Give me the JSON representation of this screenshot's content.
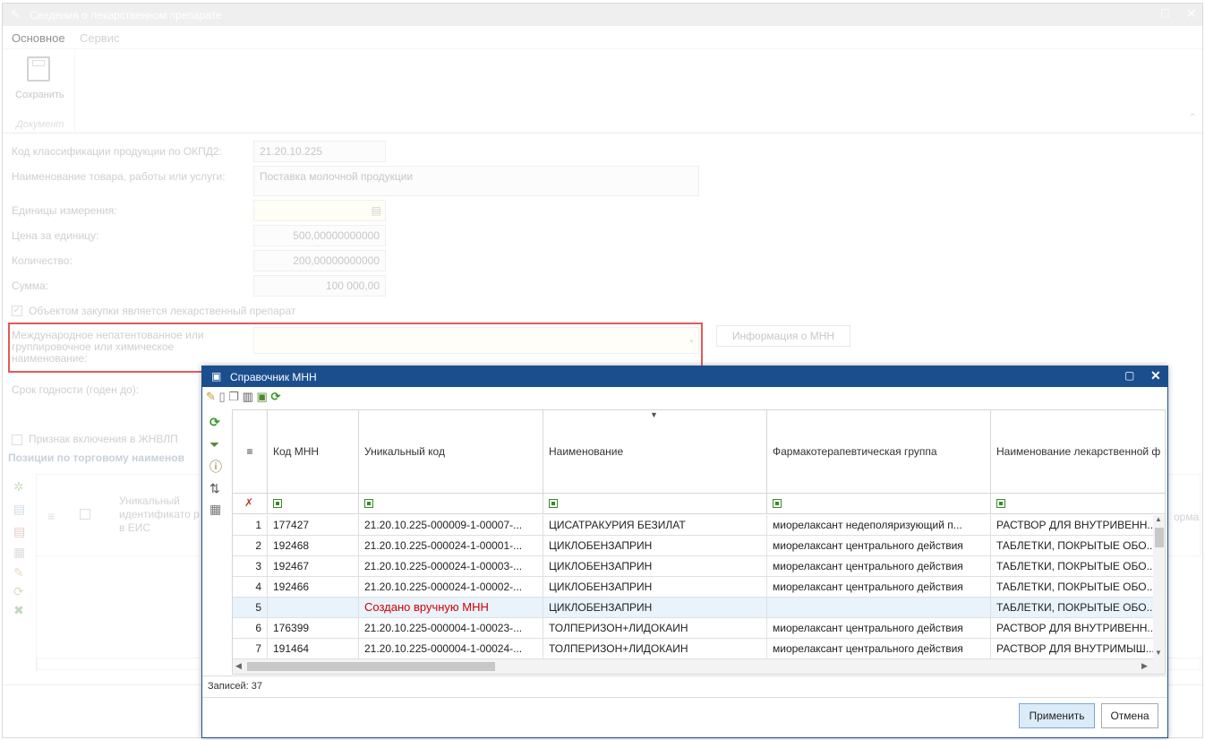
{
  "window": {
    "title": "Сведения о лекарственном препарате"
  },
  "ribbon": {
    "tabs": [
      "Основное",
      "Сервис"
    ],
    "save_label": "Сохранить",
    "group_label": "Документ"
  },
  "form": {
    "okpd_label": "Код классификации продукции по ОКПД2:",
    "okpd_value": "21.20.10.225",
    "name_label": "Наименование товара, работы или услуги:",
    "name_value": "Поставка молочной продукции",
    "units_label": "Единицы измерения:",
    "units_value": "",
    "price_label": "Цена за единицу:",
    "price_value": "500,00000000000",
    "qty_label": "Количество:",
    "qty_value": "200,00000000000",
    "sum_label": "Сумма:",
    "sum_value": "100 000,00",
    "drug_checkbox_label": "Объектом закупки является лекарственный препарат",
    "mnn_label": "Международное непатентованное или группировочное или химическое наименование:",
    "mnn_value": "",
    "mnn_info_button": "Информация о МНН",
    "expiry_label": "Срок годности (годен до):",
    "jnvlp_label": "Признак включения в ЖНВЛП",
    "positions_title": "Позиции по торговому наименов",
    "positions_col_uid": "Уникальный идентификато р в ЕИС",
    "positions_col_right": "орма"
  },
  "dialog": {
    "title": "Справочник МНН",
    "columns": [
      "Код МНН",
      "Уникальный код",
      "Наименование",
      "Фармакотерапевтическая группа",
      "Наименование лекарственной ф"
    ],
    "rows": [
      {
        "n": "1",
        "code": "177427",
        "uid": "21.20.10.225-000009-1-00007-...",
        "name": "ЦИСАТРАКУРИЯ БЕЗИЛАТ",
        "group": "миорелаксант недеполяризующий п...",
        "form": "РАСТВОР ДЛЯ ВНУТРИВЕНН..."
      },
      {
        "n": "2",
        "code": "192468",
        "uid": "21.20.10.225-000024-1-00001-...",
        "name": "ЦИКЛОБЕНЗАПРИН",
        "group": "миорелаксант центрального действия",
        "form": "ТАБЛЕТКИ, ПОКРЫТЫЕ ОБО..."
      },
      {
        "n": "3",
        "code": "192467",
        "uid": "21.20.10.225-000024-1-00003-...",
        "name": "ЦИКЛОБЕНЗАПРИН",
        "group": "миорелаксант центрального действия",
        "form": "ТАБЛЕТКИ, ПОКРЫТЫЕ ОБО..."
      },
      {
        "n": "4",
        "code": "192466",
        "uid": "21.20.10.225-000024-1-00002-...",
        "name": "ЦИКЛОБЕНЗАПРИН",
        "group": "миорелаксант центрального действия",
        "form": "ТАБЛЕТКИ, ПОКРЫТЫЕ ОБО..."
      },
      {
        "n": "5",
        "code": "",
        "uid": "Создано вручную МНН",
        "name": "ЦИКЛОБЕНЗАПРИН",
        "group": "",
        "form": "ТАБЛЕТКИ, ПОКРЫТЫЕ ОБО..."
      },
      {
        "n": "6",
        "code": "176399",
        "uid": "21.20.10.225-000004-1-00023-...",
        "name": "ТОЛПЕРИЗОН+ЛИДОКАИН",
        "group": "миорелаксант центрального действия",
        "form": "РАСТВОР ДЛЯ ВНУТРИВЕНН..."
      },
      {
        "n": "7",
        "code": "191464",
        "uid": "21.20.10.225-000004-1-00024-...",
        "name": "ТОЛПЕРИЗОН+ЛИДОКАИН",
        "group": "миорелаксант центрального действия",
        "form": "РАСТВОР ДЛЯ ВНУТРИМЫШ..."
      }
    ],
    "records": "Записей: 37",
    "apply_button": "Применить",
    "cancel_button": "Отмена"
  },
  "colors": {
    "accent": "#1b4e8d",
    "highlight": "#d40000",
    "manual_text": "#d40000"
  }
}
